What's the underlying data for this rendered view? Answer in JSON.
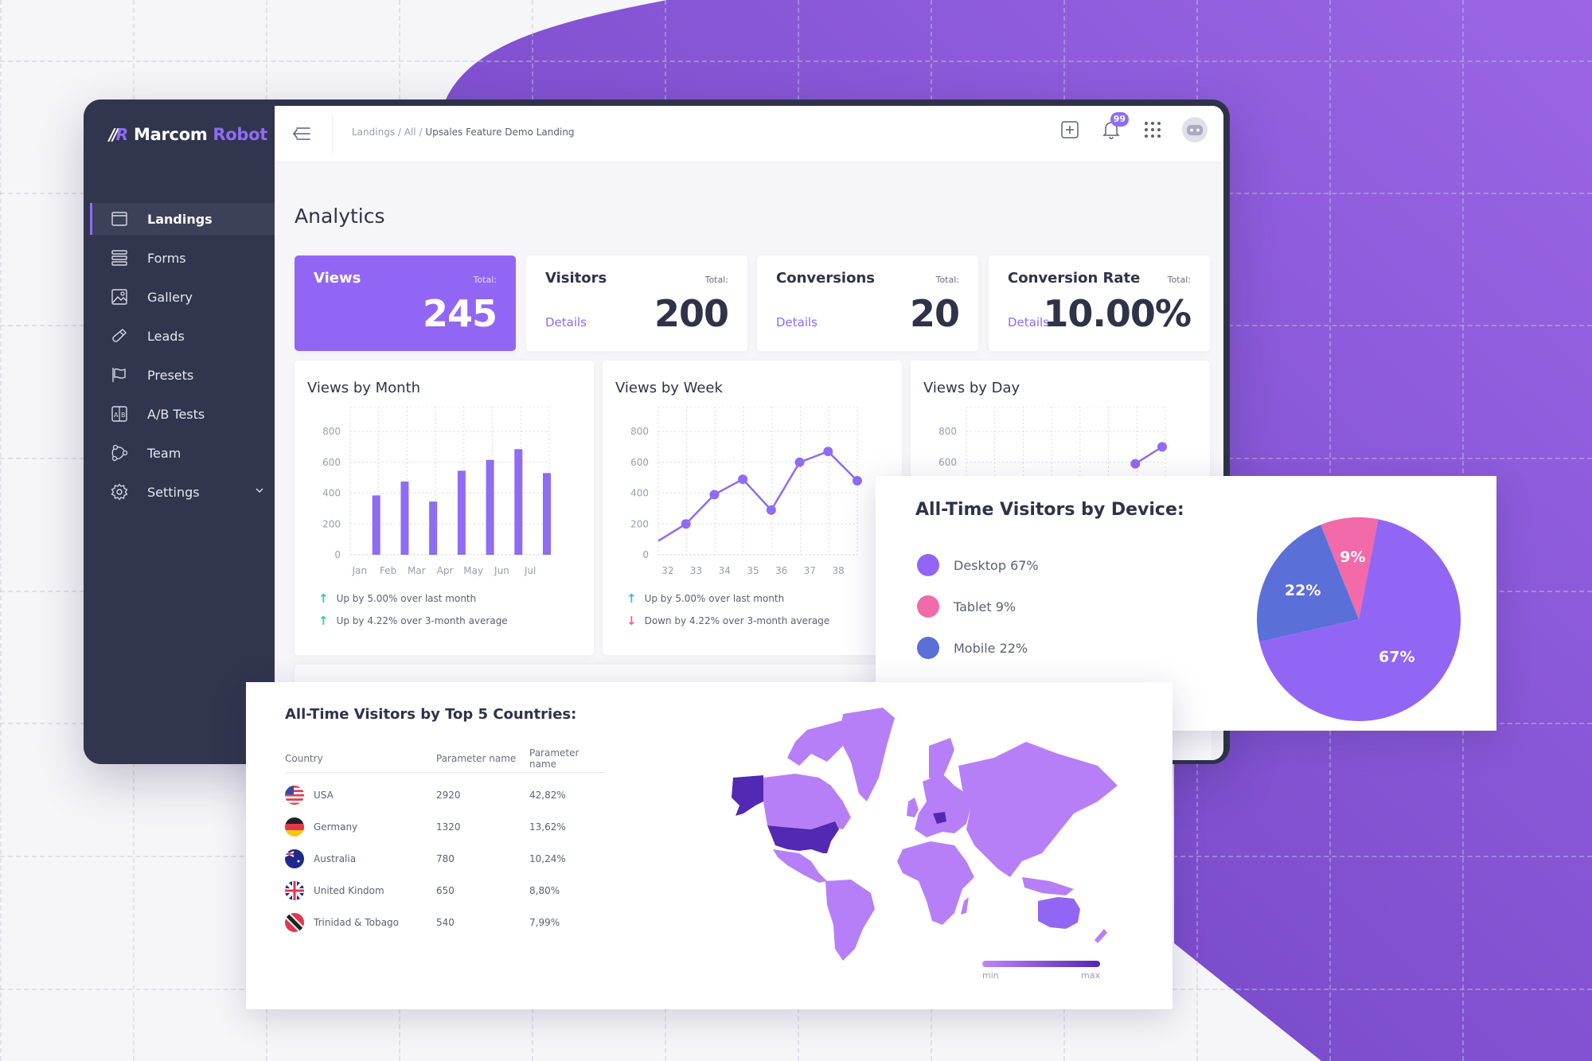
{
  "app": {
    "brand_main": "Marcom",
    "brand_accent": "Robot",
    "logo_mark": "MR"
  },
  "header": {
    "breadcrumb": [
      "Landings",
      "All",
      "Upsales Feature Demo Landing"
    ],
    "notification_count": "99"
  },
  "sidebar": {
    "items": [
      {
        "label": "Landings",
        "icon": "browser-window-icon",
        "active": true
      },
      {
        "label": "Forms",
        "icon": "forms-stack-icon"
      },
      {
        "label": "Gallery",
        "icon": "image-icon"
      },
      {
        "label": "Leads",
        "icon": "magnet-icon"
      },
      {
        "label": "Presets",
        "icon": "flag-icon"
      },
      {
        "label": "A/B Tests",
        "icon": "ab-test-icon"
      },
      {
        "label": "Team",
        "icon": "team-icon"
      },
      {
        "label": "Settings",
        "icon": "gear-icon",
        "expandable": true
      }
    ]
  },
  "page": {
    "title": "Analytics"
  },
  "stats": [
    {
      "label": "Views",
      "total_label": "Total:",
      "value": "245",
      "details": null
    },
    {
      "label": "Visitors",
      "total_label": "Total:",
      "value": "200",
      "details": "Details"
    },
    {
      "label": "Conversions",
      "total_label": "Total:",
      "value": "20",
      "details": "Details"
    },
    {
      "label": "Conversion Rate",
      "total_label": "Total:",
      "value": "10.00%",
      "details": "Details"
    }
  ],
  "colors": {
    "accent": "#8e6cf3",
    "primary_card": "#9266f5",
    "sidebar": "#31354d",
    "up": "#31c6bc",
    "down": "#ef5f9a",
    "desktop": "#9266f5",
    "tablet": "#f26aa9",
    "mobile": "#5b6fd8"
  },
  "chart_data": [
    {
      "type": "bar",
      "title": "Views by Month",
      "categories": [
        "Jan",
        "Feb",
        "Mar",
        "Apr",
        "May",
        "Jun",
        "Jul"
      ],
      "values": [
        385,
        475,
        345,
        545,
        615,
        685,
        530
      ],
      "yticks": [
        0,
        200,
        400,
        600,
        800
      ],
      "ylim": [
        0,
        960
      ],
      "grid": true,
      "trends": [
        {
          "dir": "up",
          "text": "Up by 5.00% over last month"
        },
        {
          "dir": "up",
          "text": "Up by 4.22% over 3-month average"
        }
      ]
    },
    {
      "type": "line",
      "title": "Views by Week",
      "categories": [
        "32",
        "33",
        "34",
        "35",
        "36",
        "37",
        "38"
      ],
      "lead_in_value": 90,
      "values": [
        200,
        390,
        490,
        290,
        600,
        670,
        480
      ],
      "yticks": [
        0,
        200,
        400,
        600,
        800
      ],
      "ylim": [
        0,
        960
      ],
      "grid": true,
      "trends": [
        {
          "dir": "up",
          "text": "Up by 5.00% over last month"
        },
        {
          "dir": "down",
          "text": "Down by 4.22% over 3-month average"
        }
      ]
    },
    {
      "type": "line",
      "title": "Views by Day",
      "visible_values": [
        590,
        700
      ],
      "yticks": [
        600,
        800
      ],
      "ylim": [
        0,
        960
      ],
      "grid": true
    },
    {
      "type": "pie",
      "title": "All-Time Visitors by Device:",
      "slices": [
        {
          "name": "Desktop",
          "value": 67,
          "label": "67%",
          "legend": "Desktop 67%"
        },
        {
          "name": "Tablet",
          "value": 9,
          "label": "9%",
          "legend": "Tablet 9%"
        },
        {
          "name": "Mobile",
          "value": 22,
          "label": "22%",
          "legend": "Mobile 22%"
        }
      ]
    },
    {
      "type": "table",
      "title": "All-Time Visitors by Top 5 Countries:",
      "columns": [
        "Country",
        "Parameter name",
        "Parameter name"
      ],
      "rows": [
        {
          "country": "USA",
          "flag": "us-flag-icon",
          "value": "2920",
          "share": "42,82%"
        },
        {
          "country": "Germany",
          "flag": "de-flag-icon",
          "value": "1320",
          "share": "13,62%"
        },
        {
          "country": "Australia",
          "flag": "au-flag-icon",
          "value": "780",
          "share": "10,24%"
        },
        {
          "country": "United Kindom",
          "flag": "uk-flag-icon",
          "value": "650",
          "share": "8,80%"
        },
        {
          "country": "Trinidad & Tobago",
          "flag": "tt-flag-icon",
          "value": "540",
          "share": "7,99%"
        }
      ],
      "map_legend": {
        "min": "min",
        "max": "max"
      }
    }
  ]
}
